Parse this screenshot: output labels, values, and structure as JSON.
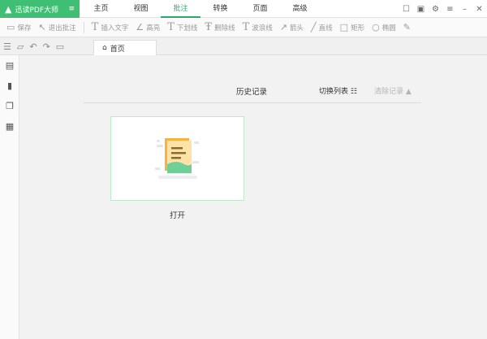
{
  "titlebar": {
    "brand_name": "迅读PDF大师",
    "brand_arrow": "≡",
    "menus": [
      "主页",
      "视图",
      "批注",
      "转换",
      "页面",
      "高级"
    ],
    "active_menu": "批注",
    "window_icons": [
      "message-icon",
      "gift-icon",
      "settings-icon",
      "menu-icon",
      "minimize-icon",
      "close-icon"
    ]
  },
  "toolbar": {
    "save": "保存",
    "exit_annotation": "退出批注",
    "insert_text": "插入文字",
    "highlight": "高亮",
    "underline": "下划线",
    "strikethrough": "删除线",
    "wavy_line": "波浪线",
    "arrow": "箭头",
    "line": "直线",
    "rectangle": "矩形",
    "ellipse": "椭圆"
  },
  "tabs": {
    "home_label": "首页"
  },
  "main": {
    "history_title": "历史记录",
    "switch_list": "切换列表",
    "clear_history": "清除记录",
    "open_label": "打开"
  },
  "colors": {
    "brand": "#3fbf74",
    "accent": "#2ea866",
    "card_border": "#bfe9cf"
  }
}
